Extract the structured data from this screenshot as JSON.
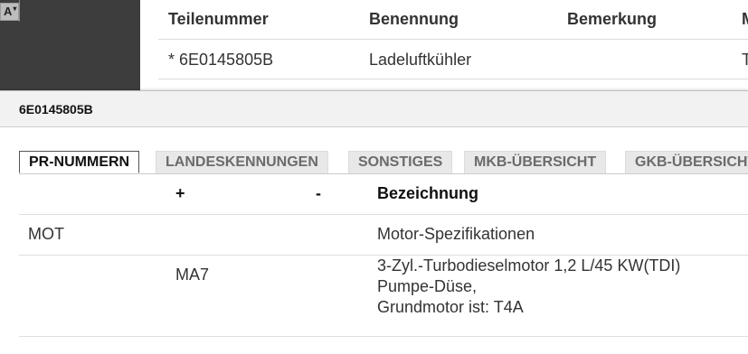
{
  "left_panel": {
    "a_label": "A",
    "caret": "▾"
  },
  "bg_table": {
    "headers": [
      "Teilenummer",
      "Benennung",
      "Bemerkung",
      "M"
    ],
    "row": [
      "* 6E0145805B",
      "Ladeluftkühler",
      "",
      "T"
    ]
  },
  "modal": {
    "title": "6E0145805B",
    "tabs": [
      "PR-NUMMERN",
      "LANDESKENNUNGEN",
      "SONSTIGES",
      "MKB-ÜBERSICHT",
      "GKB-ÜBERSICHT"
    ],
    "active_tab": "PR-NUMMERN",
    "table": {
      "headers": [
        "",
        "+",
        "-",
        "Bezeichnung"
      ],
      "rows": [
        {
          "code": "MOT",
          "plus": "",
          "minus": "",
          "desc": [
            "Motor-Spezifikationen"
          ]
        },
        {
          "code": "",
          "plus": "MA7",
          "minus": "",
          "desc": [
            "3-Zyl.-Turbodieselmotor 1,2 L/45 KW(TDI)",
            "Pumpe-Düse,",
            "Grundmotor ist: T4A"
          ]
        }
      ]
    }
  }
}
